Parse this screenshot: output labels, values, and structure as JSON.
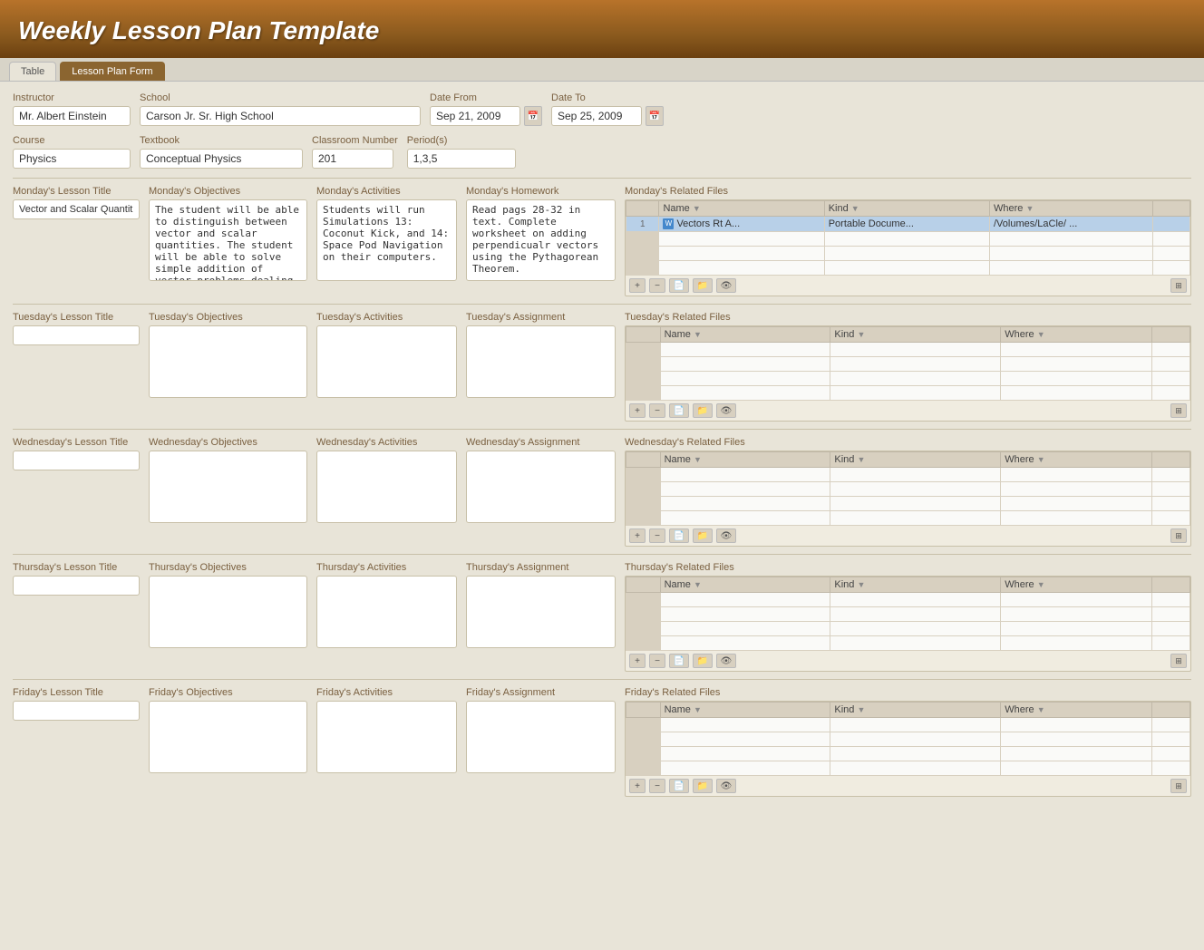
{
  "header": {
    "title": "Weekly Lesson Plan Template"
  },
  "tabs": [
    {
      "label": "Table",
      "active": false
    },
    {
      "label": "Lesson Plan Form",
      "active": true
    }
  ],
  "form": {
    "instructor_label": "Instructor",
    "instructor_value": "Mr. Albert Einstein",
    "school_label": "School",
    "school_value": "Carson Jr. Sr. High School",
    "date_from_label": "Date From",
    "date_from_value": "Sep 21, 2009",
    "date_to_label": "Date To",
    "date_to_value": "Sep 25, 2009",
    "course_label": "Course",
    "course_value": "Physics",
    "textbook_label": "Textbook",
    "textbook_value": "Conceptual Physics",
    "classroom_label": "Classroom Number",
    "classroom_value": "201",
    "periods_label": "Period(s)",
    "periods_value": "1,3,5"
  },
  "days": [
    {
      "id": "monday",
      "title_label": "Monday's Lesson Title",
      "title_value": "Vector and Scalar Quantities",
      "objectives_label": "Monday's Objectives",
      "objectives_value": "The student will be able to distinguish between vector and scalar quantities. The student will be able to solve simple addition of vector problems dealing with Velocity Vectors",
      "activities_label": "Monday's Activities",
      "activities_value": "Students will run Simulations 13: Coconut Kick, and 14: Space Pod Navigation on their computers.",
      "homework_label": "Monday's Homework",
      "homework_value": "Read pags 28-32 in text. Complete worksheet on adding perpendicualr vectors using the Pythagorean Theorem.",
      "files_label": "Monday's Related Files",
      "files": [
        {
          "num": "1",
          "name": "Vectors Rt A...",
          "kind": "Portable Docume...",
          "where": "/Volumes/LaCle/ ...",
          "selected": true
        }
      ]
    },
    {
      "id": "tuesday",
      "title_label": "Tuesday's Lesson Title",
      "title_value": "",
      "objectives_label": "Tuesday's Objectives",
      "objectives_value": "",
      "activities_label": "Tuesday's Activities",
      "activities_value": "",
      "homework_label": "Tuesday's Assignment",
      "homework_value": "",
      "files_label": "Tuesday's Related Files",
      "files": []
    },
    {
      "id": "wednesday",
      "title_label": "Wednesday's Lesson Title",
      "title_value": "",
      "objectives_label": "Wednesday's Objectives",
      "objectives_value": "",
      "activities_label": "Wednesday's Activities",
      "activities_value": "",
      "homework_label": "Wednesday's Assignment",
      "homework_value": "",
      "files_label": "Wednesday's Related Files",
      "files": []
    },
    {
      "id": "thursday",
      "title_label": "Thursday's Lesson Title",
      "title_value": "",
      "objectives_label": "Thursday's Objectives",
      "objectives_value": "",
      "activities_label": "Thursday's Activities",
      "activities_value": "",
      "homework_label": "Thursday's Assignment",
      "homework_value": "",
      "files_label": "Thursday's Related Files",
      "files": []
    },
    {
      "id": "friday",
      "title_label": "Friday's Lesson Title",
      "title_value": "",
      "objectives_label": "Friday's Objectives",
      "objectives_value": "",
      "activities_label": "Friday's Activities",
      "activities_value": "",
      "homework_label": "Friday's Assignment",
      "homework_value": "",
      "files_label": "Friday's Related Files",
      "files": []
    }
  ],
  "table_headers": {
    "name": "Name",
    "kind": "Kind",
    "where": "Where"
  },
  "toolbar_icons": {
    "add": "+",
    "remove": "−",
    "new_file": "📄",
    "folder": "📁",
    "eye": "👁",
    "grid": "⊞"
  }
}
